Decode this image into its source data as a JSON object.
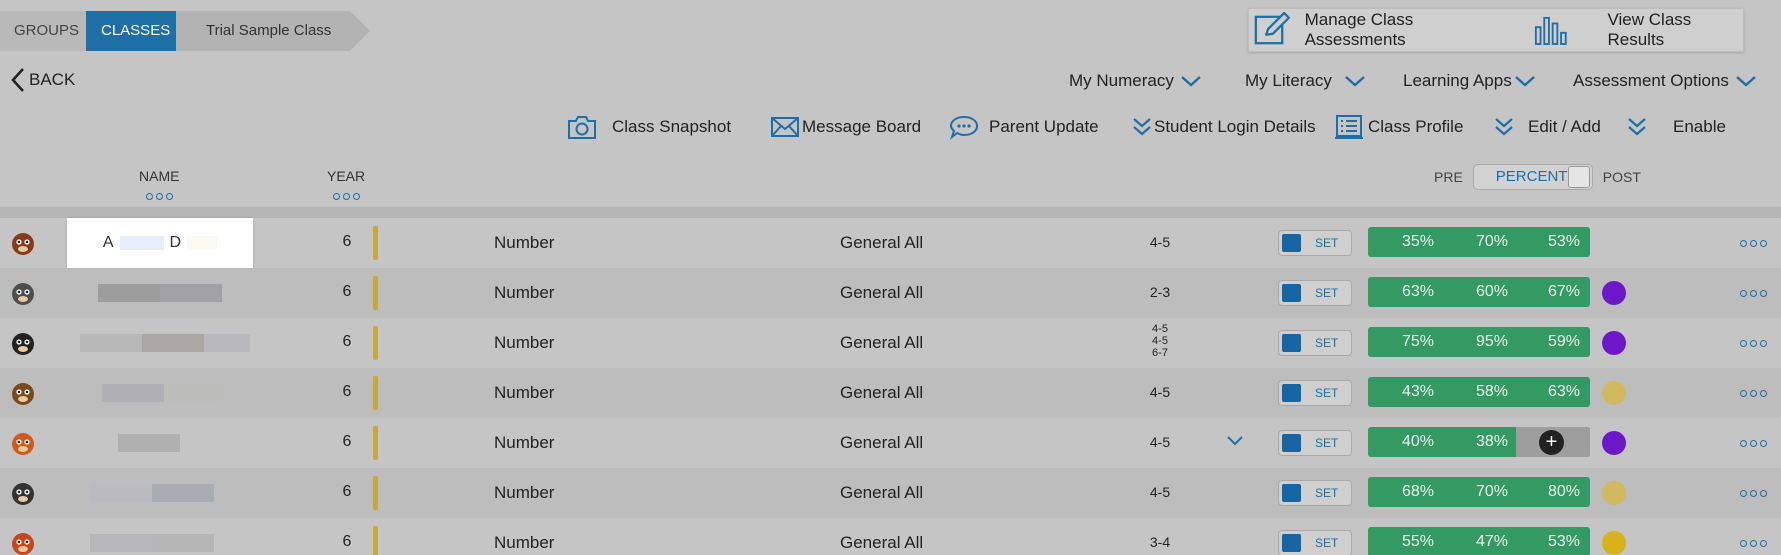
{
  "breadcrumb": {
    "groups": "GROUPS",
    "classes": "CLASSES",
    "current": "Trial Sample Class"
  },
  "top_actions": {
    "manage": "Manage Class Assessments",
    "results": "View Class Results"
  },
  "back_label": "BACK",
  "menus": [
    "My Numeracy",
    "My Literacy",
    "Learning Apps",
    "Assessment Options"
  ],
  "toolbar": {
    "snapshot": "Class Snapshot",
    "message_board": "Message Board",
    "parent_update": "Parent Update",
    "student_login": "Student Login Details",
    "class_profile": "Class Profile",
    "edit_add": "Edit / Add",
    "enable": "Enable"
  },
  "columns": {
    "name": "NAME",
    "year": "YEAR"
  },
  "toggle": {
    "pre": "PRE",
    "percent": "PERCENT",
    "post": "POST"
  },
  "set_label": "SET",
  "colors": {
    "accent": "#1e6fa6",
    "score_green": "#339a63",
    "year_bar": "#c9a73a",
    "purple": "#6c18c9",
    "tan": "#d1b95f",
    "gold": "#d8b21a"
  },
  "students": [
    {
      "avatar": "monkey-avatar",
      "name_first": "A",
      "name_last": "D",
      "year": "6",
      "subject": "Number",
      "assessment": "General All",
      "level": "4-5",
      "scores": [
        "35%",
        "70%",
        "53%"
      ],
      "status_color": ""
    },
    {
      "avatar": "wolf-avatar",
      "year": "6",
      "subject": "Number",
      "assessment": "General All",
      "level": "2-3",
      "scores": [
        "63%",
        "60%",
        "67%"
      ],
      "status_color": "#6c18c9"
    },
    {
      "avatar": "penguin-avatar",
      "year": "6",
      "subject": "Number",
      "assessment": "General All",
      "level_lines": [
        "4-5",
        "4-5",
        "6-7"
      ],
      "scores": [
        "75%",
        "95%",
        "59%"
      ],
      "status_color": "#6c18c9"
    },
    {
      "avatar": "dog-avatar",
      "year": "6",
      "subject": "Number",
      "assessment": "General All",
      "level": "4-5",
      "scores": [
        "43%",
        "58%",
        "63%"
      ],
      "status_color": "#d1b95f"
    },
    {
      "avatar": "fox-avatar",
      "year": "6",
      "subject": "Number",
      "assessment": "General All",
      "level": "4-5",
      "scores": [
        "40%",
        "38%"
      ],
      "status_color": "#6c18c9"
    },
    {
      "avatar": "panda-avatar",
      "year": "6",
      "subject": "Number",
      "assessment": "General All",
      "level": "4-5",
      "scores": [
        "68%",
        "70%",
        "80%"
      ],
      "status_color": "#d1b95f"
    },
    {
      "avatar": "fox2-avatar",
      "year": "6",
      "subject": "Number",
      "assessment": "General All",
      "level": "3-4",
      "scores": [
        "55%",
        "47%",
        "53%"
      ],
      "status_color": "#d8b21a"
    }
  ]
}
